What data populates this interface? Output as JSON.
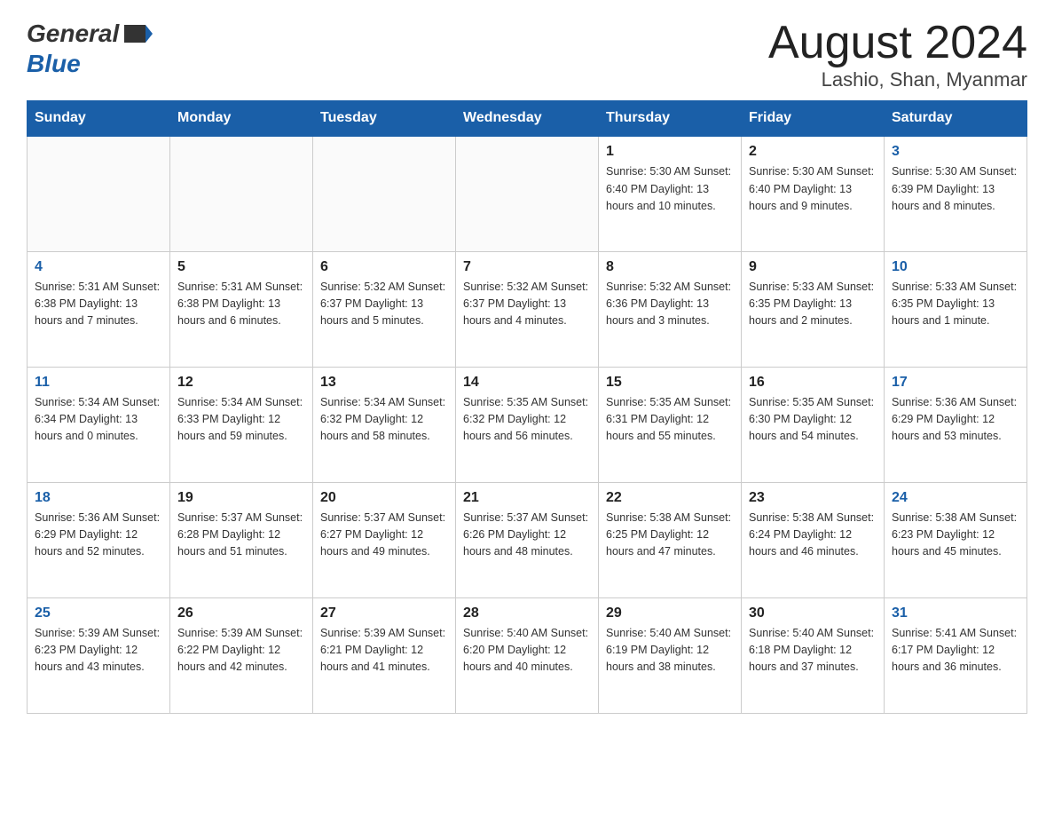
{
  "header": {
    "logo_general": "General",
    "logo_blue": "Blue",
    "month_title": "August 2024",
    "location": "Lashio, Shan, Myanmar"
  },
  "days_of_week": [
    "Sunday",
    "Monday",
    "Tuesday",
    "Wednesday",
    "Thursday",
    "Friday",
    "Saturday"
  ],
  "weeks": [
    [
      {
        "day": "",
        "info": ""
      },
      {
        "day": "",
        "info": ""
      },
      {
        "day": "",
        "info": ""
      },
      {
        "day": "",
        "info": ""
      },
      {
        "day": "1",
        "info": "Sunrise: 5:30 AM\nSunset: 6:40 PM\nDaylight: 13 hours\nand 10 minutes."
      },
      {
        "day": "2",
        "info": "Sunrise: 5:30 AM\nSunset: 6:40 PM\nDaylight: 13 hours\nand 9 minutes."
      },
      {
        "day": "3",
        "info": "Sunrise: 5:30 AM\nSunset: 6:39 PM\nDaylight: 13 hours\nand 8 minutes."
      }
    ],
    [
      {
        "day": "4",
        "info": "Sunrise: 5:31 AM\nSunset: 6:38 PM\nDaylight: 13 hours\nand 7 minutes."
      },
      {
        "day": "5",
        "info": "Sunrise: 5:31 AM\nSunset: 6:38 PM\nDaylight: 13 hours\nand 6 minutes."
      },
      {
        "day": "6",
        "info": "Sunrise: 5:32 AM\nSunset: 6:37 PM\nDaylight: 13 hours\nand 5 minutes."
      },
      {
        "day": "7",
        "info": "Sunrise: 5:32 AM\nSunset: 6:37 PM\nDaylight: 13 hours\nand 4 minutes."
      },
      {
        "day": "8",
        "info": "Sunrise: 5:32 AM\nSunset: 6:36 PM\nDaylight: 13 hours\nand 3 minutes."
      },
      {
        "day": "9",
        "info": "Sunrise: 5:33 AM\nSunset: 6:35 PM\nDaylight: 13 hours\nand 2 minutes."
      },
      {
        "day": "10",
        "info": "Sunrise: 5:33 AM\nSunset: 6:35 PM\nDaylight: 13 hours\nand 1 minute."
      }
    ],
    [
      {
        "day": "11",
        "info": "Sunrise: 5:34 AM\nSunset: 6:34 PM\nDaylight: 13 hours\nand 0 minutes."
      },
      {
        "day": "12",
        "info": "Sunrise: 5:34 AM\nSunset: 6:33 PM\nDaylight: 12 hours\nand 59 minutes."
      },
      {
        "day": "13",
        "info": "Sunrise: 5:34 AM\nSunset: 6:32 PM\nDaylight: 12 hours\nand 58 minutes."
      },
      {
        "day": "14",
        "info": "Sunrise: 5:35 AM\nSunset: 6:32 PM\nDaylight: 12 hours\nand 56 minutes."
      },
      {
        "day": "15",
        "info": "Sunrise: 5:35 AM\nSunset: 6:31 PM\nDaylight: 12 hours\nand 55 minutes."
      },
      {
        "day": "16",
        "info": "Sunrise: 5:35 AM\nSunset: 6:30 PM\nDaylight: 12 hours\nand 54 minutes."
      },
      {
        "day": "17",
        "info": "Sunrise: 5:36 AM\nSunset: 6:29 PM\nDaylight: 12 hours\nand 53 minutes."
      }
    ],
    [
      {
        "day": "18",
        "info": "Sunrise: 5:36 AM\nSunset: 6:29 PM\nDaylight: 12 hours\nand 52 minutes."
      },
      {
        "day": "19",
        "info": "Sunrise: 5:37 AM\nSunset: 6:28 PM\nDaylight: 12 hours\nand 51 minutes."
      },
      {
        "day": "20",
        "info": "Sunrise: 5:37 AM\nSunset: 6:27 PM\nDaylight: 12 hours\nand 49 minutes."
      },
      {
        "day": "21",
        "info": "Sunrise: 5:37 AM\nSunset: 6:26 PM\nDaylight: 12 hours\nand 48 minutes."
      },
      {
        "day": "22",
        "info": "Sunrise: 5:38 AM\nSunset: 6:25 PM\nDaylight: 12 hours\nand 47 minutes."
      },
      {
        "day": "23",
        "info": "Sunrise: 5:38 AM\nSunset: 6:24 PM\nDaylight: 12 hours\nand 46 minutes."
      },
      {
        "day": "24",
        "info": "Sunrise: 5:38 AM\nSunset: 6:23 PM\nDaylight: 12 hours\nand 45 minutes."
      }
    ],
    [
      {
        "day": "25",
        "info": "Sunrise: 5:39 AM\nSunset: 6:23 PM\nDaylight: 12 hours\nand 43 minutes."
      },
      {
        "day": "26",
        "info": "Sunrise: 5:39 AM\nSunset: 6:22 PM\nDaylight: 12 hours\nand 42 minutes."
      },
      {
        "day": "27",
        "info": "Sunrise: 5:39 AM\nSunset: 6:21 PM\nDaylight: 12 hours\nand 41 minutes."
      },
      {
        "day": "28",
        "info": "Sunrise: 5:40 AM\nSunset: 6:20 PM\nDaylight: 12 hours\nand 40 minutes."
      },
      {
        "day": "29",
        "info": "Sunrise: 5:40 AM\nSunset: 6:19 PM\nDaylight: 12 hours\nand 38 minutes."
      },
      {
        "day": "30",
        "info": "Sunrise: 5:40 AM\nSunset: 6:18 PM\nDaylight: 12 hours\nand 37 minutes."
      },
      {
        "day": "31",
        "info": "Sunrise: 5:41 AM\nSunset: 6:17 PM\nDaylight: 12 hours\nand 36 minutes."
      }
    ]
  ]
}
